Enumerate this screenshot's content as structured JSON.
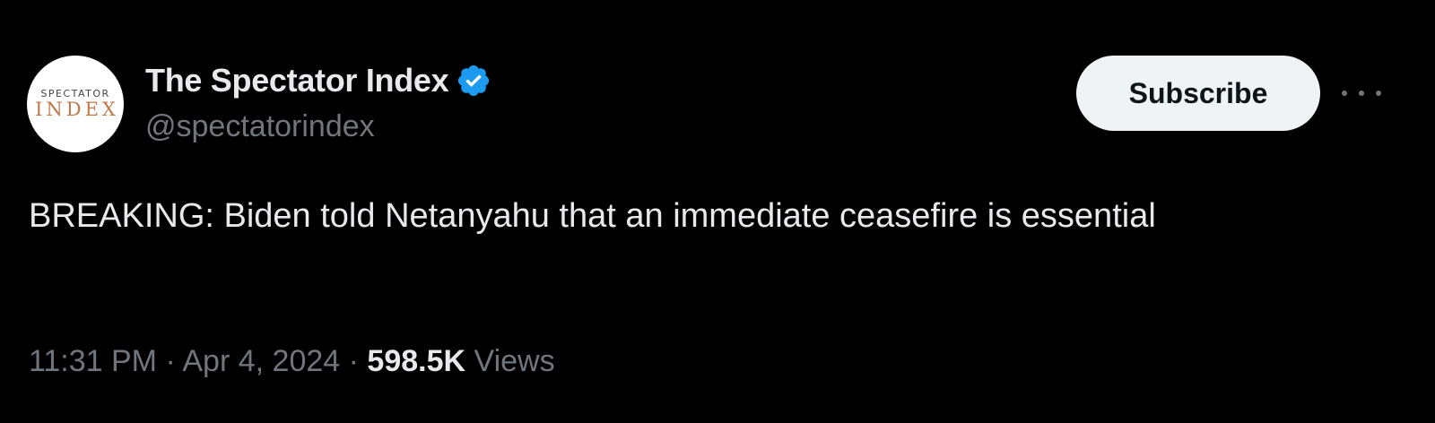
{
  "author": {
    "avatar_text_top": "SPECTATOR",
    "avatar_text_bottom": "INDEX",
    "display_name": "The Spectator Index",
    "handle": "@spectatorindex",
    "verified_icon": "verified-badge-icon",
    "verified_color": "#1d9bf0"
  },
  "actions": {
    "subscribe_label": "Subscribe",
    "more_icon": "more-options-icon"
  },
  "tweet": {
    "text": "BREAKING: Biden told Netanyahu that an immediate ceasefire is essential"
  },
  "meta": {
    "time": "11:31 PM",
    "separator": "·",
    "date": "Apr 4, 2024",
    "views_count": "598.5K",
    "views_label": "Views"
  },
  "colors": {
    "background": "#000000",
    "primary_text": "#e7e9ea",
    "secondary_text": "#71767b",
    "button_bg": "#eff3f4",
    "avatar_accent": "#c0794a"
  }
}
